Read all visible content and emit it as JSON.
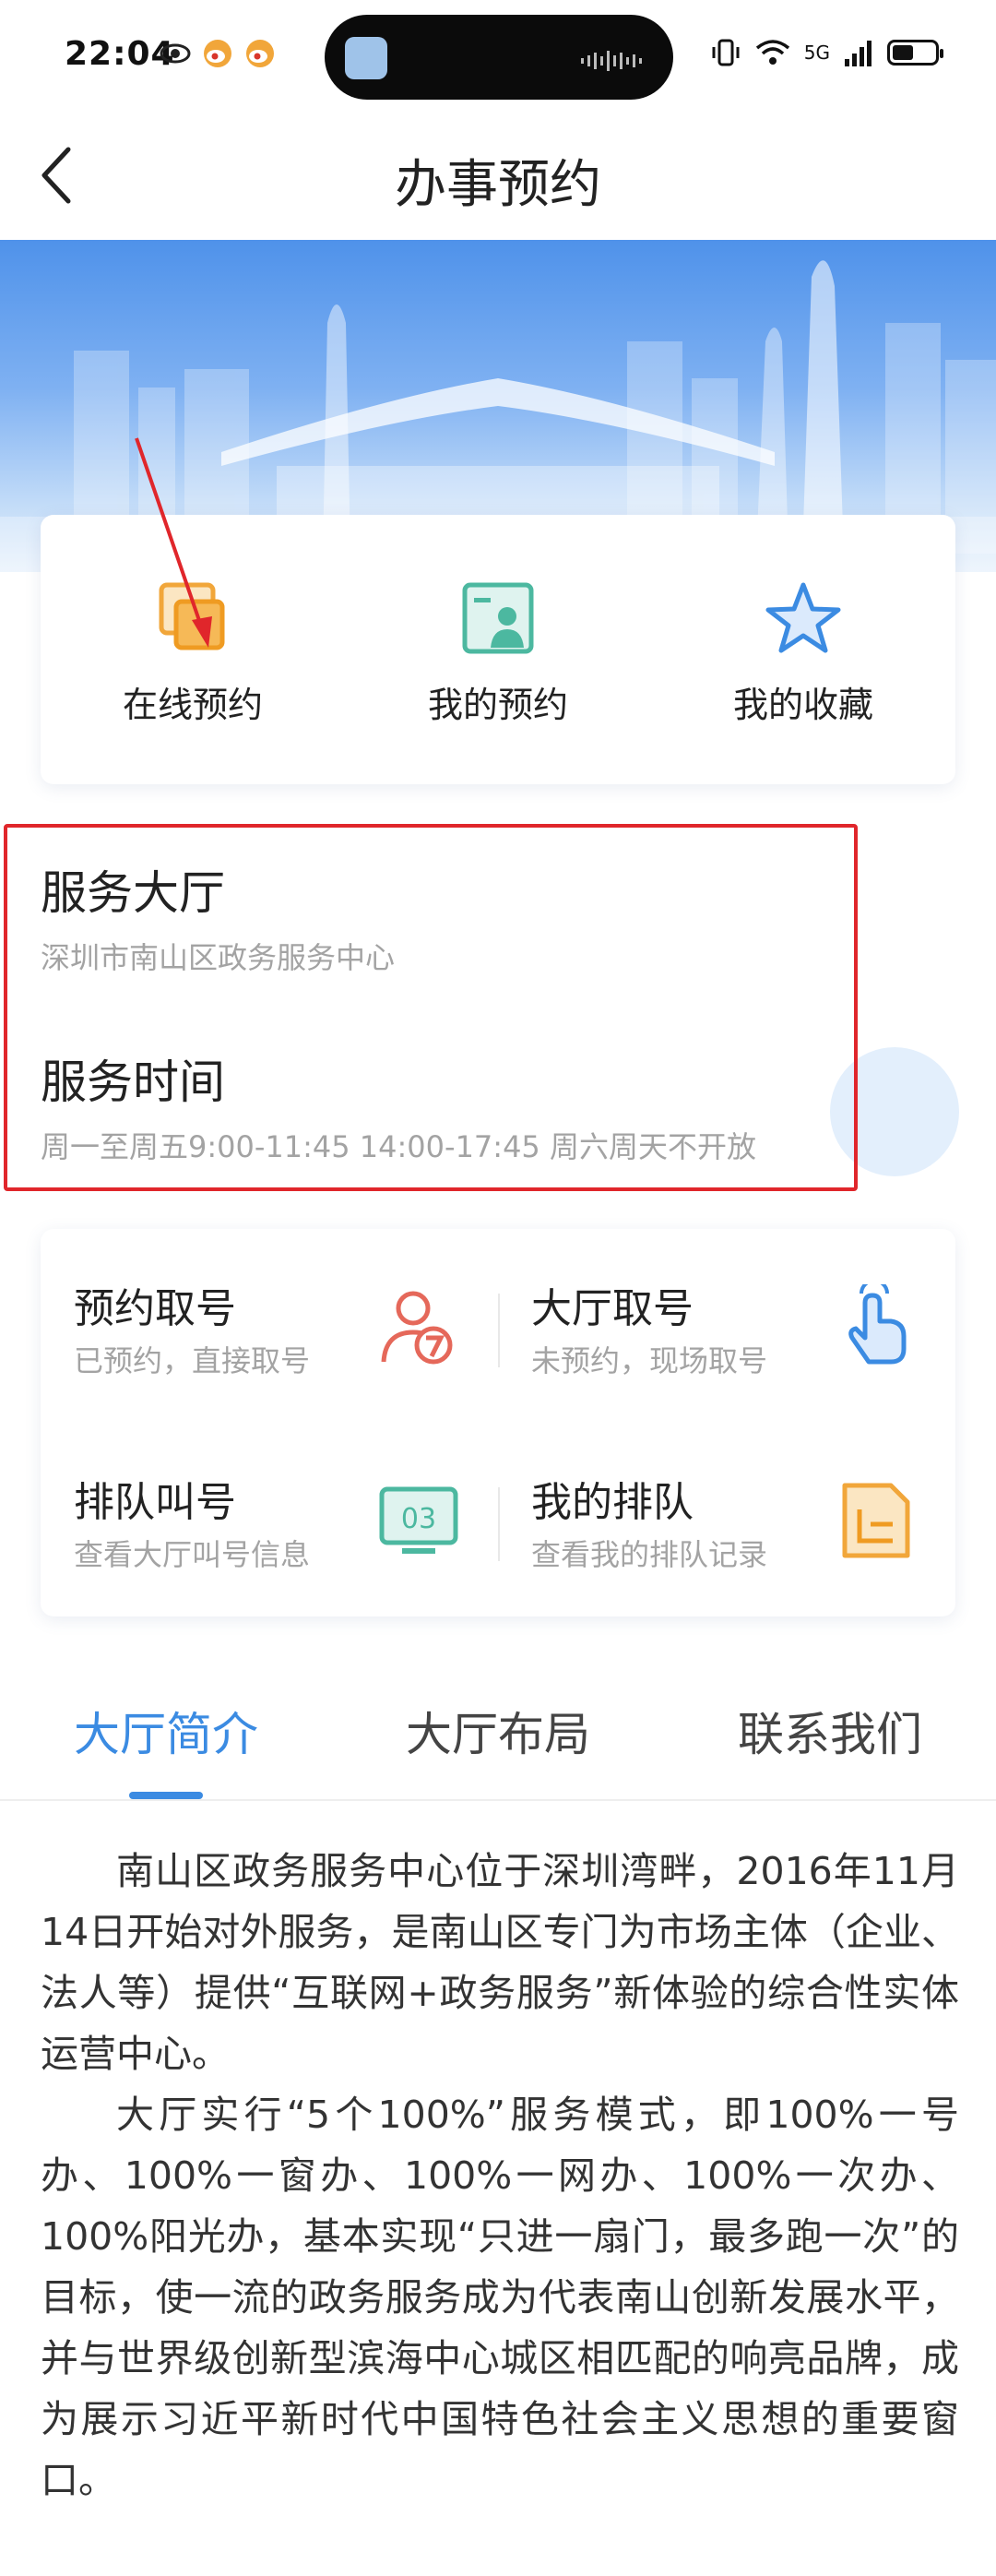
{
  "status_bar": {
    "time": "22:04",
    "network": "5G",
    "icons": [
      "eye-icon",
      "weibo-icon",
      "weibo-icon",
      "vibrate-icon",
      "wifi-icon",
      "signal-icon",
      "battery-icon"
    ]
  },
  "header": {
    "title": "办事预约",
    "back_icon": "chevron-left-icon"
  },
  "quick_actions": [
    {
      "label": "在线预约",
      "icon": "online-booking-icon"
    },
    {
      "label": "我的预约",
      "icon": "my-booking-icon"
    },
    {
      "label": "我的收藏",
      "icon": "star-icon"
    }
  ],
  "hall": {
    "title": "服务大厅",
    "name": "深圳市南山区政务服务中心",
    "time_title": "服务时间",
    "hours": "周一至周五9:00-11:45 14:00-17:45 周六周天不开放"
  },
  "services": [
    {
      "title": "预约取号",
      "subtitle": "已预约，直接取号",
      "icon": "reservation-number-icon"
    },
    {
      "title": "大厅取号",
      "subtitle": "未预约，现场取号",
      "icon": "tap-hand-icon"
    },
    {
      "title": "排队叫号",
      "subtitle": "查看大厅叫号信息",
      "icon": "queue-display-icon",
      "badge": "03"
    },
    {
      "title": "我的排队",
      "subtitle": "查看我的排队记录",
      "icon": "document-icon"
    }
  ],
  "tabs": [
    {
      "label": "大厅简介",
      "active": true
    },
    {
      "label": "大厅布局",
      "active": false
    },
    {
      "label": "联系我们",
      "active": false
    }
  ],
  "intro": {
    "paragraph1": "南山区政务服务中心位于深圳湾畔，2016年11月14日开始对外服务，是南山区专门为市场主体（企业、法人等）提供“互联网+政务服务”新体验的综合性实体运营中心。",
    "paragraph2": "大厅实行“5个100%”服务模式，即100%一号办、100%一窗办、100%一网办、100%一次办、100%阳光办，基本实现“只进一扇门，最多跑一次”的目标，使一流的政务服务成为代表南山创新发展水平，并与世界级创新型滨海中心城区相匹配的响亮品牌，成为展示习近平新时代中国特色社会主义思想的重要窗口。"
  },
  "colors": {
    "accent": "#3b8be2",
    "highlight": "#e0262b",
    "subtext": "#a3a3a3"
  }
}
